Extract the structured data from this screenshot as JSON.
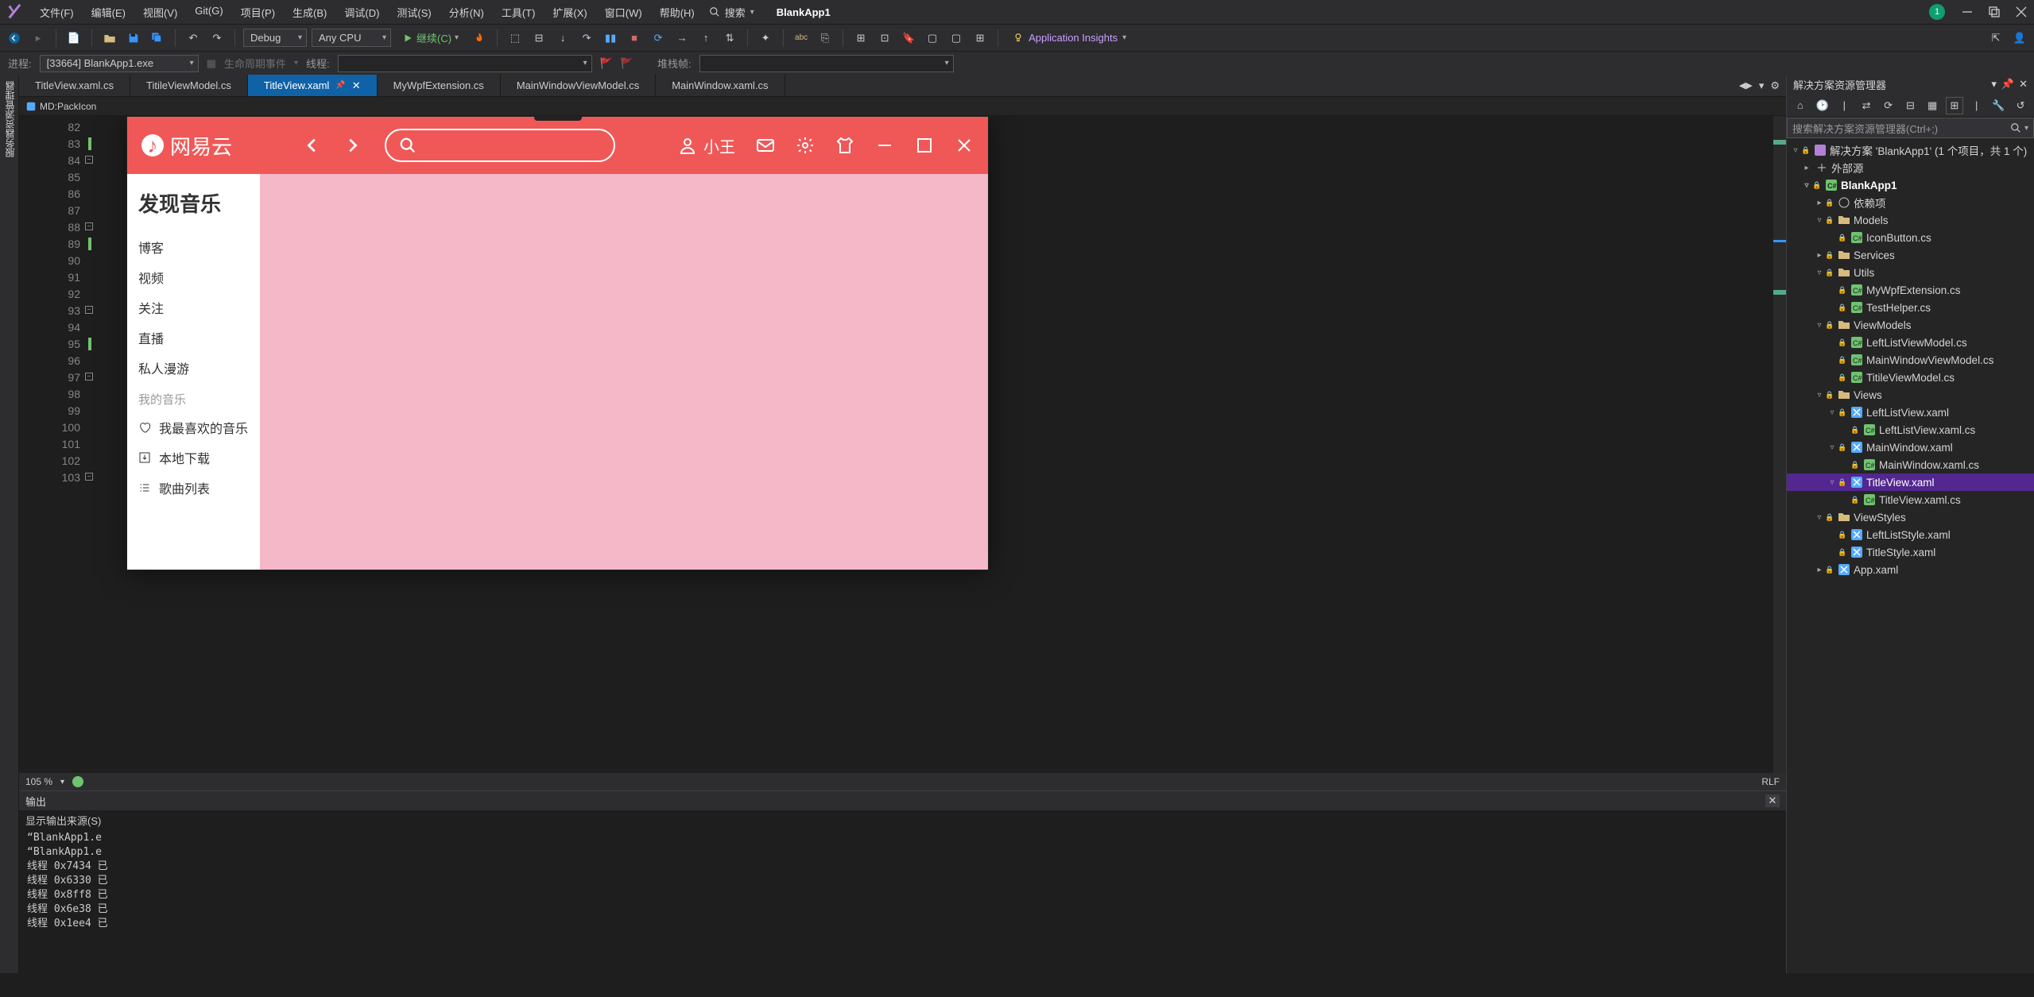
{
  "menubar": {
    "items": [
      "文件(F)",
      "编辑(E)",
      "视图(V)",
      "Git(G)",
      "项目(P)",
      "生成(B)",
      "调试(D)",
      "测试(S)",
      "分析(N)",
      "工具(T)",
      "扩展(X)",
      "窗口(W)",
      "帮助(H)"
    ],
    "search_label": "搜索",
    "app_name": "BlankApp1",
    "badge": "1"
  },
  "toolbar": {
    "config": "Debug",
    "platform": "Any CPU",
    "continue": "继续(C)",
    "app_insights": "Application Insights"
  },
  "toolbar2": {
    "process_label": "进程:",
    "process_value": "[33664] BlankApp1.exe",
    "lifecycle": "生命周期事件",
    "thread_label": "线程:",
    "stackframe_label": "堆栈帧:"
  },
  "left_strip": "服务器资源管理器",
  "tabs": [
    {
      "label": "TitleView.xaml.cs",
      "active": false
    },
    {
      "label": "TitileViewModel.cs",
      "active": false
    },
    {
      "label": "TitleView.xaml",
      "active": true
    },
    {
      "label": "MyWpfExtension.cs",
      "active": false
    },
    {
      "label": "MainWindowViewModel.cs",
      "active": false
    },
    {
      "label": "MainWindow.xaml.cs",
      "active": false
    }
  ],
  "breadcrumb": "MD:PackIcon",
  "gutter": {
    "start": 82,
    "end": 103,
    "current": 98
  },
  "editor_status": {
    "zoom": "105 %",
    "encoding_short": "RLF"
  },
  "app": {
    "brand": "网易云",
    "user": "小王",
    "side_heading": "发现音乐",
    "side_items": [
      "博客",
      "视频",
      "关注",
      "直播",
      "私人漫游"
    ],
    "side_label": "我的音乐",
    "side_items2": [
      {
        "icon": "heart",
        "label": "我最喜欢的音乐"
      },
      {
        "icon": "download",
        "label": "本地下载"
      },
      {
        "icon": "list",
        "label": "歌曲列表"
      }
    ]
  },
  "output": {
    "title": "输出",
    "source_label": "显示输出来源(S)",
    "lines": [
      "“BlankApp1.e",
      "“BlankApp1.e",
      "线程 0x7434 已",
      "线程 0x6330 已",
      "线程 0x8ff8 已",
      "线程 0x6e38 已",
      "线程 0x1ee4 已"
    ]
  },
  "solution": {
    "title": "解决方案资源管理器",
    "search_placeholder": "搜索解决方案资源管理器(Ctrl+;)",
    "root": "解决方案 'BlankApp1' (1 个项目，共 1 个)",
    "project": "BlankApp1",
    "refs": "外部源",
    "deps": "依赖项",
    "folders": {
      "Models": [
        "IconButton.cs"
      ],
      "Services": [],
      "Utils": [
        "MyWpfExtension.cs",
        "TestHelper.cs"
      ],
      "ViewModels": [
        "LeftListViewModel.cs",
        "MainWindowViewModel.cs",
        "TitileViewModel.cs"
      ],
      "Views": [
        {
          "name": "LeftListView.xaml",
          "children": [
            "LeftListView.xaml.cs"
          ]
        },
        {
          "name": "MainWindow.xaml",
          "children": [
            "MainWindow.xaml.cs"
          ]
        },
        {
          "name": "TitleView.xaml",
          "children": [
            "TitleView.xaml.cs"
          ],
          "selected": true
        }
      ],
      "ViewStyles": [
        "LeftListStyle.xaml",
        "TitleStyle.xaml"
      ]
    },
    "appxaml": "App.xaml"
  }
}
